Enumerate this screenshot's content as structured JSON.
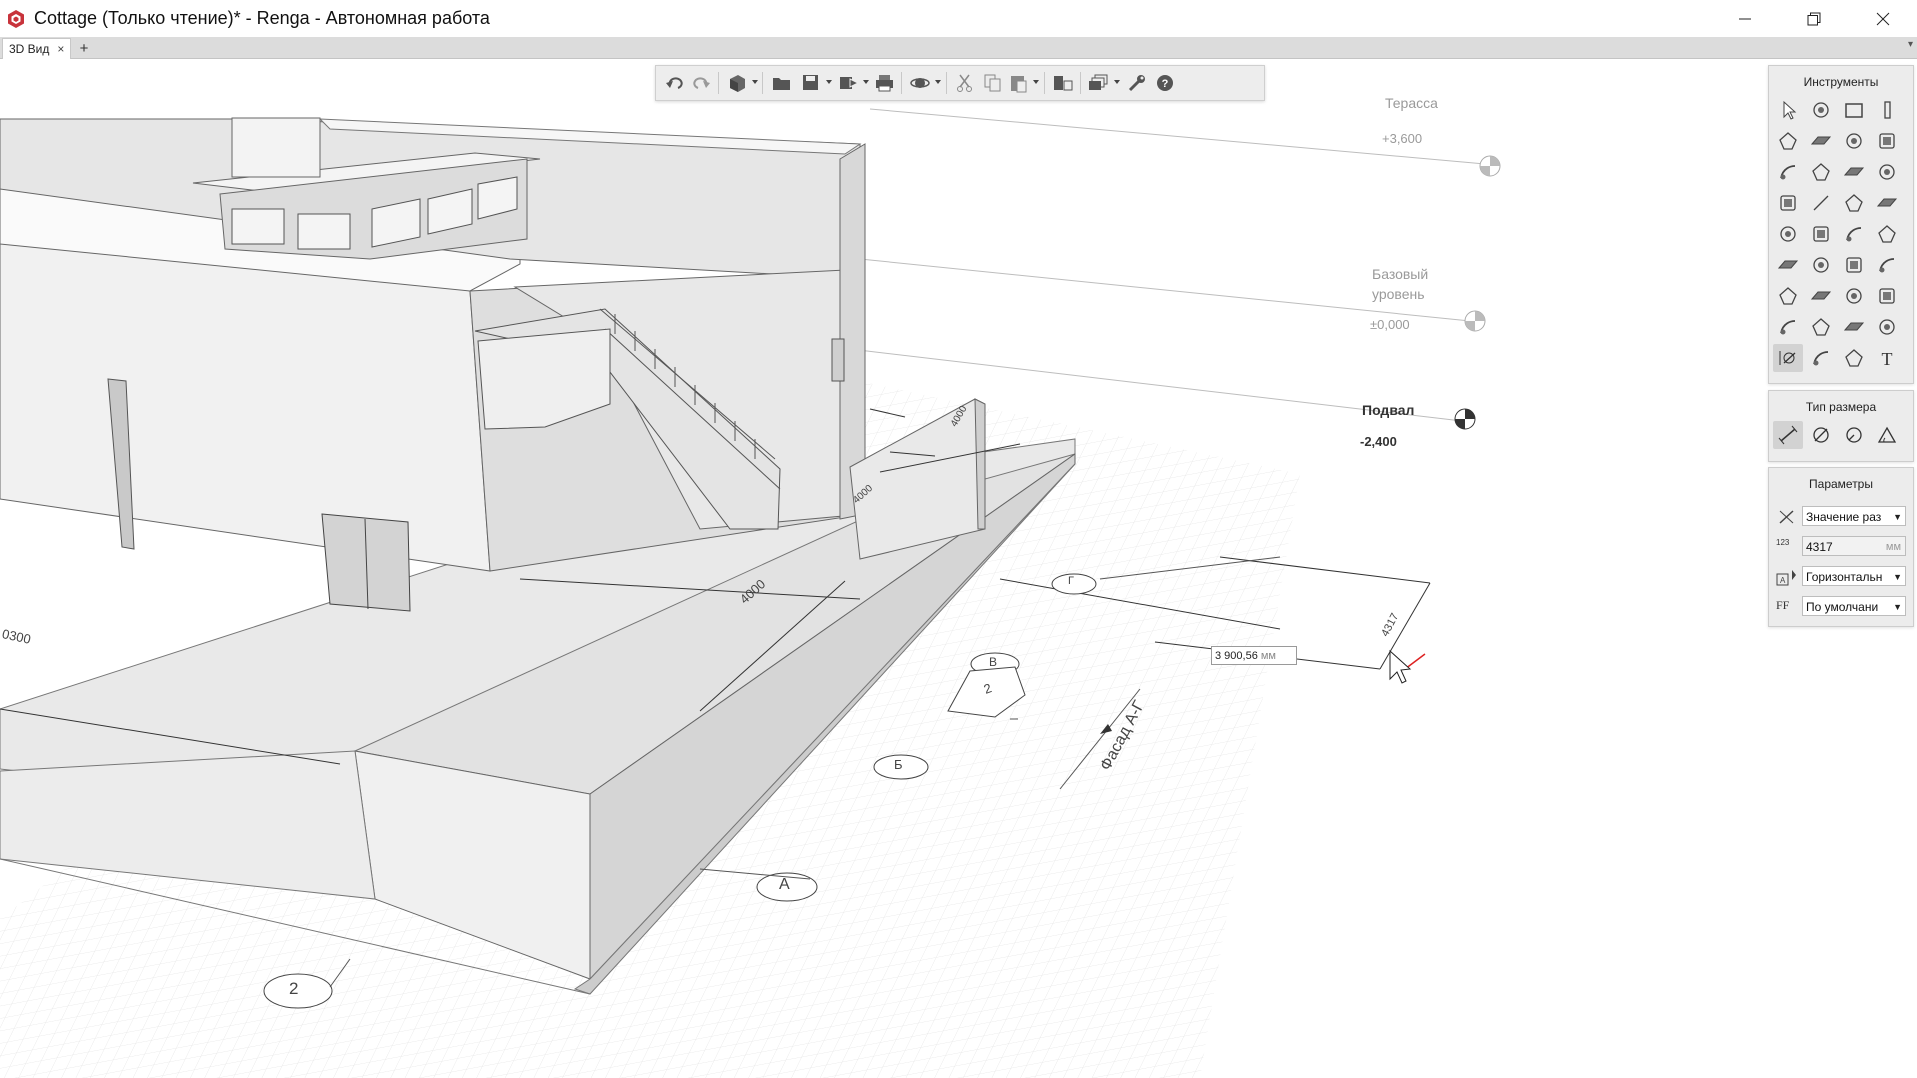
{
  "window": {
    "title": "Cottage (Только чтение)* - Renga - Автономная работа",
    "brand_color": "#c8333b",
    "controls": [
      "minimize-icon",
      "restore-icon",
      "close-icon"
    ]
  },
  "tabs": {
    "items": [
      {
        "label": "3D Вид",
        "active": true
      }
    ],
    "add_label": "+",
    "close_label": "×",
    "menu_label": "▾"
  },
  "toolbar": {
    "buttons": [
      "undo-icon",
      "redo-icon",
      "view-cube-icon",
      "open-folder-icon",
      "save-icon",
      "export-icon",
      "print-icon",
      "orbit-icon",
      "cut-icon",
      "copy-icon",
      "paste-icon",
      "visibility-icon",
      "layers-icon",
      "settings-wrench-icon",
      "help-icon"
    ]
  },
  "panels": {
    "tools": {
      "title": "Инструменты",
      "icons": [
        "select-icon",
        "assembly-icon",
        "wall-icon",
        "column-icon",
        "slab-icon",
        "floor-icon",
        "roof-icon",
        "beam-icon",
        "stair-icon",
        "ramp-icon",
        "door-icon",
        "window-icon",
        "railing-icon",
        "line-icon",
        "room-icon",
        "pipe-icon",
        "plumbing-icon",
        "equipment-icon",
        "duct-icon",
        "fitting-icon",
        "pump-icon",
        "tank-icon",
        "valve-icon",
        "elbow-icon",
        "cable-icon",
        "lamp-icon",
        "switch-icon",
        "socket-icon",
        "panel-icon",
        "shape-icon",
        "level-icon",
        "label-icon",
        "dimension-icon",
        "leader-icon",
        "hatch-icon",
        "text-icon"
      ],
      "active_index": 32
    },
    "dim_type": {
      "title": "Тип размера",
      "icons": [
        "linear-dim-icon",
        "diameter-dim-icon",
        "radius-dim-icon",
        "angle-dim-icon"
      ]
    },
    "params": {
      "title": "Параметры",
      "rows": [
        {
          "icon": "dim-value-icon",
          "value": "Значение раз",
          "type": "select"
        },
        {
          "icon": "number-icon",
          "icon_text": "123",
          "value": "4317",
          "unit": "мм",
          "type": "input"
        },
        {
          "icon": "text-orientation-icon",
          "value": "Горизонтальн",
          "type": "select"
        },
        {
          "icon": "font-icon",
          "icon_text": "FF",
          "value": "По умолчани",
          "type": "select"
        }
      ]
    }
  },
  "viewport": {
    "levels": [
      {
        "name": "Терасса",
        "value": "+3,600"
      },
      {
        "name": "Базовый\nуровень",
        "value": "±0,000"
      },
      {
        "name": "Подвал",
        "value": "-2,400"
      }
    ],
    "dim_input": {
      "value": "3 900,56",
      "unit": "мм"
    },
    "dim_labels": {
      "d4317": "4317",
      "d4000a": "4000",
      "d4000b": "4000",
      "d4000c": "4000",
      "d0300": "0300"
    },
    "axes": {
      "g": "Г",
      "v": "В",
      "b": "Б",
      "a": "А",
      "n2": "2",
      "n2b": "2"
    },
    "facade": "Фасад А-Г"
  }
}
